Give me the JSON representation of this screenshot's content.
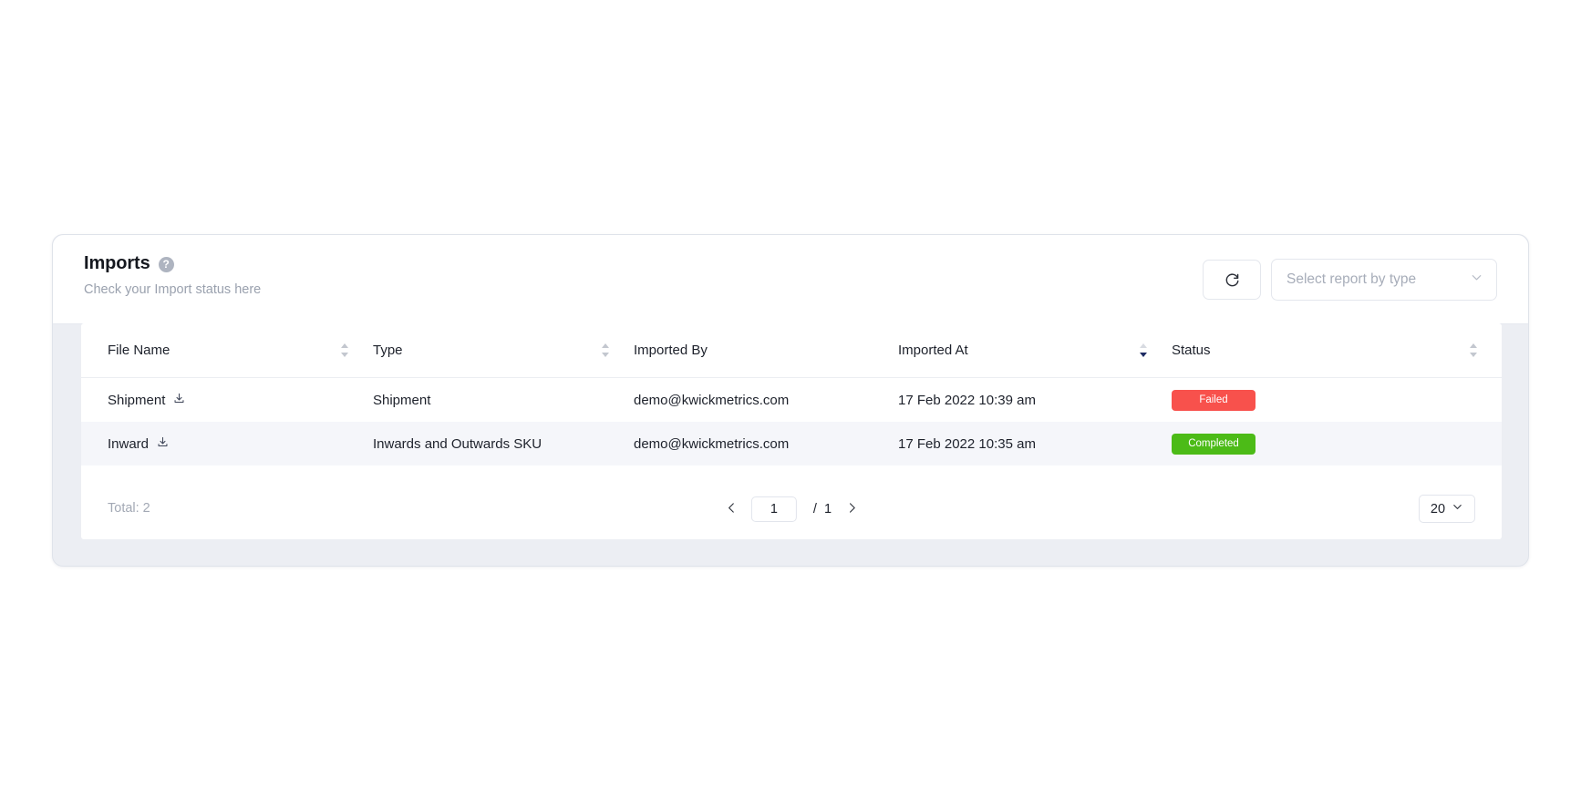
{
  "card": {
    "title": "Imports",
    "subtitle": "Check your Import status here",
    "help_icon": "question-mark-icon"
  },
  "toolbar": {
    "refresh_icon": "refresh-icon",
    "report_type_placeholder": "Select report by type",
    "report_type_value": "",
    "chevron_icon": "chevron-down-icon"
  },
  "table": {
    "columns": [
      {
        "label": "File Name",
        "sortable": true,
        "sort": "none"
      },
      {
        "label": "Type",
        "sortable": true,
        "sort": "none"
      },
      {
        "label": "Imported By",
        "sortable": false,
        "sort": "none"
      },
      {
        "label": "Imported At",
        "sortable": true,
        "sort": "desc"
      },
      {
        "label": "Status",
        "sortable": true,
        "sort": "none"
      }
    ],
    "rows": [
      {
        "file_name": "Shipment",
        "download_icon": "download-icon",
        "type": "Shipment",
        "imported_by": "demo@kwickmetrics.com",
        "imported_at": "17 Feb 2022 10:39 am",
        "status": "Failed",
        "status_color": "#f8514c"
      },
      {
        "file_name": "Inward",
        "download_icon": "download-icon",
        "type": "Inwards and Outwards SKU",
        "imported_by": "demo@kwickmetrics.com",
        "imported_at": "17 Feb 2022 10:35 am",
        "status": "Completed",
        "status_color": "#4cbb17"
      }
    ]
  },
  "footer": {
    "total_label": "Total: 2",
    "prev_icon": "chevron-left-icon",
    "next_icon": "chevron-right-icon",
    "current_page": "1",
    "page_separator": " /  1",
    "page_size": "20",
    "page_size_chevron": "chevron-down-icon"
  },
  "colors": {
    "failed": "#f8514c",
    "completed": "#4cbb17",
    "sort_active": "#1d2b63",
    "card_bg": "#eceef3"
  }
}
